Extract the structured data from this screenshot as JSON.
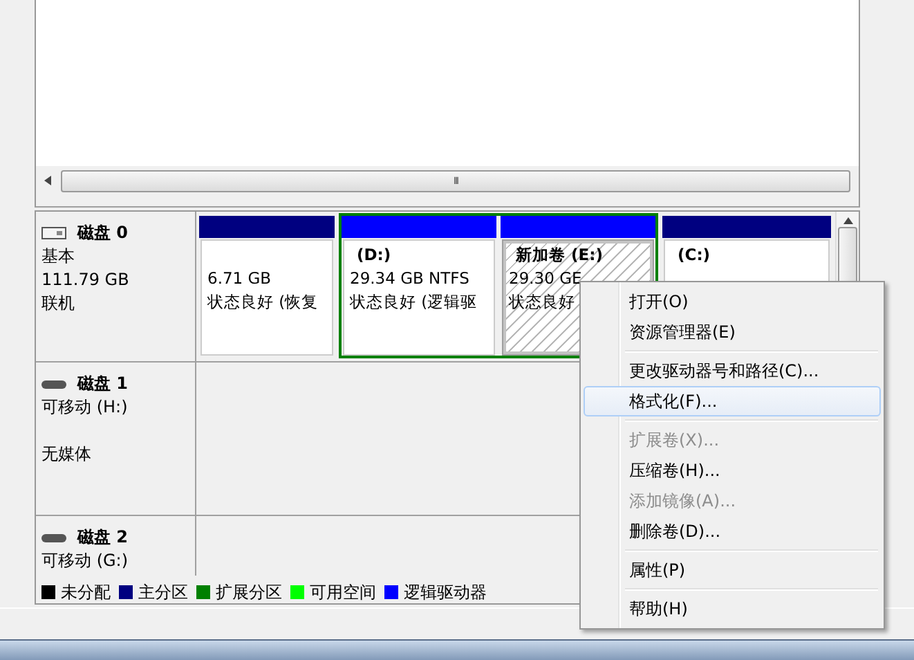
{
  "volume_list": {
    "scroll_grip": "III"
  },
  "disks": [
    {
      "kind": "basic",
      "name": "磁盘 0",
      "type": "基本",
      "size": "111.79 GB",
      "status": "联机",
      "partitions": [
        {
          "kind": "primary",
          "color": "#000080",
          "size": "6.71 GB",
          "status": "状态良好 (恢复",
          "selected": false
        },
        {
          "kind": "extended",
          "color": "#008000",
          "children": [
            {
              "kind": "logical",
              "color": "#0000ff",
              "label": "(D:)",
              "size": "29.34 GB NTFS",
              "status": "状态良好 (逻辑驱",
              "selected": false
            },
            {
              "kind": "logical",
              "color": "#0000ff",
              "label": "新加卷  (E:)",
              "size": "29.30 GE",
              "status": "状态良好",
              "selected": true
            }
          ]
        },
        {
          "kind": "primary",
          "color": "#000080",
          "label": "(C:)",
          "selected": false
        }
      ]
    },
    {
      "kind": "removable",
      "name": "磁盘 1",
      "type": "可移动 (H:)",
      "status": "无媒体"
    },
    {
      "kind": "removable",
      "name": "磁盘 2",
      "type": "可移动 (G:)"
    }
  ],
  "legend": [
    {
      "label": "未分配",
      "color": "#000000"
    },
    {
      "label": "主分区",
      "color": "#000080"
    },
    {
      "label": "扩展分区",
      "color": "#008000"
    },
    {
      "label": "可用空间",
      "color": "#00ff00"
    },
    {
      "label": "逻辑驱动器",
      "color": "#0000ff"
    }
  ],
  "context_menu": [
    {
      "kind": "item",
      "label": "打开(O)",
      "disabled": false,
      "selected": false
    },
    {
      "kind": "item",
      "label": "资源管理器(E)",
      "disabled": false,
      "selected": false
    },
    {
      "kind": "separator"
    },
    {
      "kind": "item",
      "label": "更改驱动器号和路径(C)...",
      "disabled": false,
      "selected": false
    },
    {
      "kind": "item",
      "label": "格式化(F)...",
      "disabled": false,
      "selected": true
    },
    {
      "kind": "separator"
    },
    {
      "kind": "item",
      "label": "扩展卷(X)...",
      "disabled": true,
      "selected": false
    },
    {
      "kind": "item",
      "label": "压缩卷(H)...",
      "disabled": false,
      "selected": false
    },
    {
      "kind": "item",
      "label": "添加镜像(A)...",
      "disabled": true,
      "selected": false
    },
    {
      "kind": "item",
      "label": "删除卷(D)...",
      "disabled": false,
      "selected": false
    },
    {
      "kind": "separator"
    },
    {
      "kind": "item",
      "label": "属性(P)",
      "disabled": false,
      "selected": false
    },
    {
      "kind": "separator"
    },
    {
      "kind": "item",
      "label": "帮助(H)",
      "disabled": false,
      "selected": false
    }
  ]
}
